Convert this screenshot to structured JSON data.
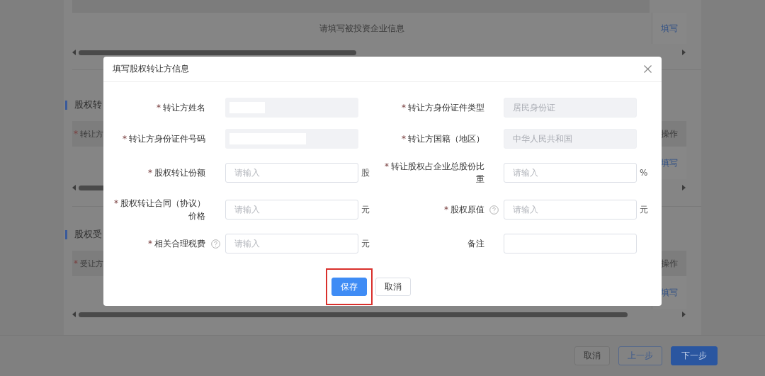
{
  "background": {
    "top_table": {
      "empty_text": "请填写被投资企业信息",
      "action": "填写"
    },
    "sections": [
      {
        "title": "股权转",
        "header_mark": "*",
        "header": "转让方",
        "action_header": "操作",
        "action": "填写"
      },
      {
        "title": "股权受",
        "header_mark": "*",
        "header": "受让方",
        "action_header": "操作",
        "action": "填写"
      }
    ],
    "footer_buttons": [
      {
        "label": "取消",
        "kind": "default"
      },
      {
        "label": "上一步",
        "kind": "outline"
      },
      {
        "label": "下一步",
        "kind": "primary"
      }
    ]
  },
  "modal": {
    "title": "填写股权转让方信息",
    "fields": [
      {
        "label": "转让方姓名",
        "required": "*",
        "kind": "disabled",
        "redacted": true
      },
      {
        "label": "转让方身份证件类型",
        "required": "*",
        "kind": "disabled",
        "value": "居民身份证"
      },
      {
        "label": "转让方身份证件号码",
        "required": "*",
        "kind": "disabled",
        "redacted": true
      },
      {
        "label": "转让方国籍（地区）",
        "required": "*",
        "kind": "disabled",
        "value": "中华人民共和国"
      },
      {
        "label": "股权转让份额",
        "required": "*",
        "kind": "input",
        "placeholder": "请输入",
        "unit": "股"
      },
      {
        "label": "转让股权占企业总股份比重",
        "required": "*",
        "kind": "input",
        "placeholder": "请输入",
        "unit": "%"
      },
      {
        "label": "股权转让合同（协议）价格",
        "required": "*",
        "kind": "input",
        "placeholder": "请输入",
        "unit": "元"
      },
      {
        "label": "股权原值",
        "required": "*",
        "kind": "input",
        "placeholder": "请输入",
        "unit": "元",
        "help": true
      },
      {
        "label": "相关合理税费",
        "required": "*",
        "kind": "input",
        "placeholder": "请输入",
        "unit": "元",
        "help": true
      },
      {
        "label": "备注",
        "kind": "input"
      }
    ],
    "buttons": [
      {
        "label": "保存",
        "kind": "primary",
        "highlighted": true
      },
      {
        "label": "取消",
        "kind": "default",
        "highlighted": false
      }
    ]
  }
}
